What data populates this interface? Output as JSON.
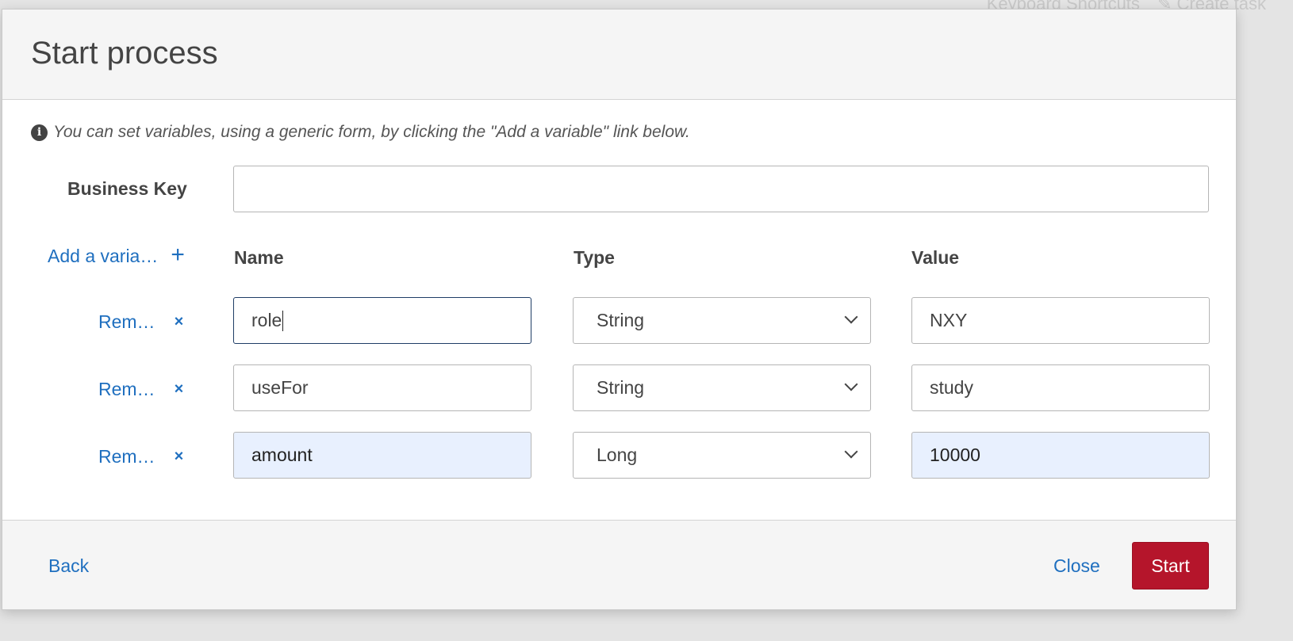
{
  "background": {
    "keyboard_shortcuts": "Keyboard Shortcuts",
    "create_task": "Create task"
  },
  "modal": {
    "title": "Start process",
    "hint": "You can set variables, using a generic form, by clicking the \"Add a variable\" link below.",
    "business_key_label": "Business Key",
    "business_key_value": "",
    "add_variable_label": "Add a varia…",
    "columns": {
      "name": "Name",
      "type": "Type",
      "value": "Value"
    },
    "remove_label": "Rem…",
    "variables": [
      {
        "name": "role",
        "type": "String",
        "value": "NXY"
      },
      {
        "name": "useFor",
        "type": "String",
        "value": "study"
      },
      {
        "name": "amount",
        "type": "Long",
        "value": "10000"
      }
    ],
    "footer": {
      "back": "Back",
      "close": "Close",
      "start": "Start"
    }
  },
  "colors": {
    "link": "#1f6fbf",
    "primary_button": "#b5152b",
    "autofill_bg": "#e8f0fe",
    "header_bg": "#f5f5f5"
  }
}
